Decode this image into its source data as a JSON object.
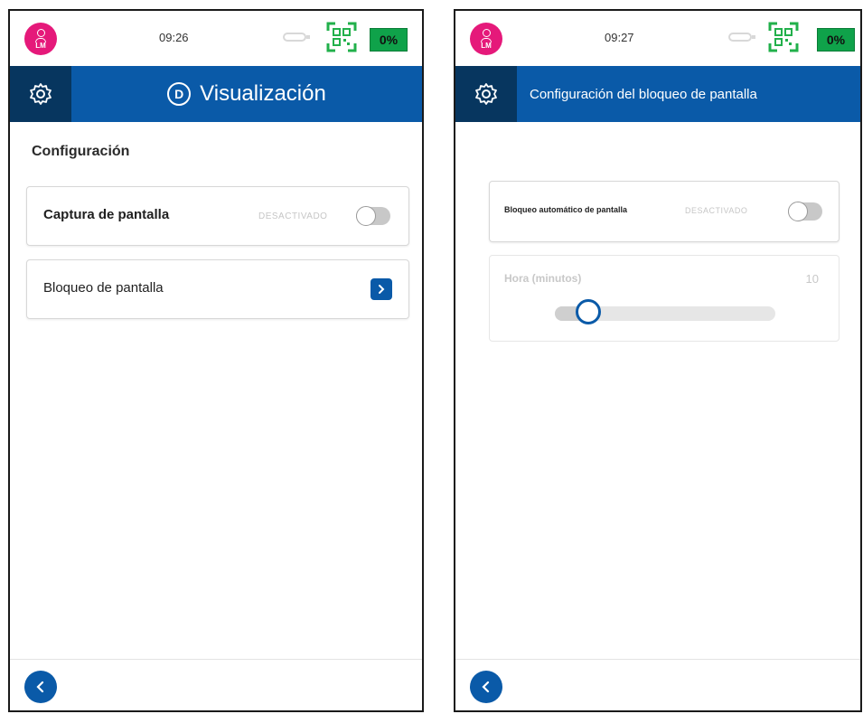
{
  "colors": {
    "accent": "#0a5aa8",
    "accent_dark": "#07365f",
    "avatar": "#e5197a",
    "battery": "#0fa24a"
  },
  "left": {
    "status": {
      "avatar_initials": "LM",
      "time": "09:26",
      "battery": "0%"
    },
    "title": "Visualización",
    "section_title": "Configuración",
    "items": [
      {
        "label": "Captura de pantalla",
        "state": "DESACTIVADO",
        "enabled": false
      },
      {
        "label": "Bloqueo de pantalla"
      }
    ]
  },
  "right": {
    "status": {
      "avatar_initials": "LM",
      "time": "09:27",
      "battery": "0%"
    },
    "title": "Configuración del bloqueo de pantalla",
    "auto_lock": {
      "label": "Bloqueo automático de pantalla",
      "state": "DESACTIVADO",
      "enabled": false
    },
    "time": {
      "label": "Hora (minutos)",
      "value": "10",
      "slider_fraction": 0.15
    }
  },
  "icons": [
    "user-icon",
    "signal-icon",
    "qr-code-icon",
    "gear-icon",
    "info-icon",
    "chevron-right-icon",
    "chevron-left-icon"
  ]
}
